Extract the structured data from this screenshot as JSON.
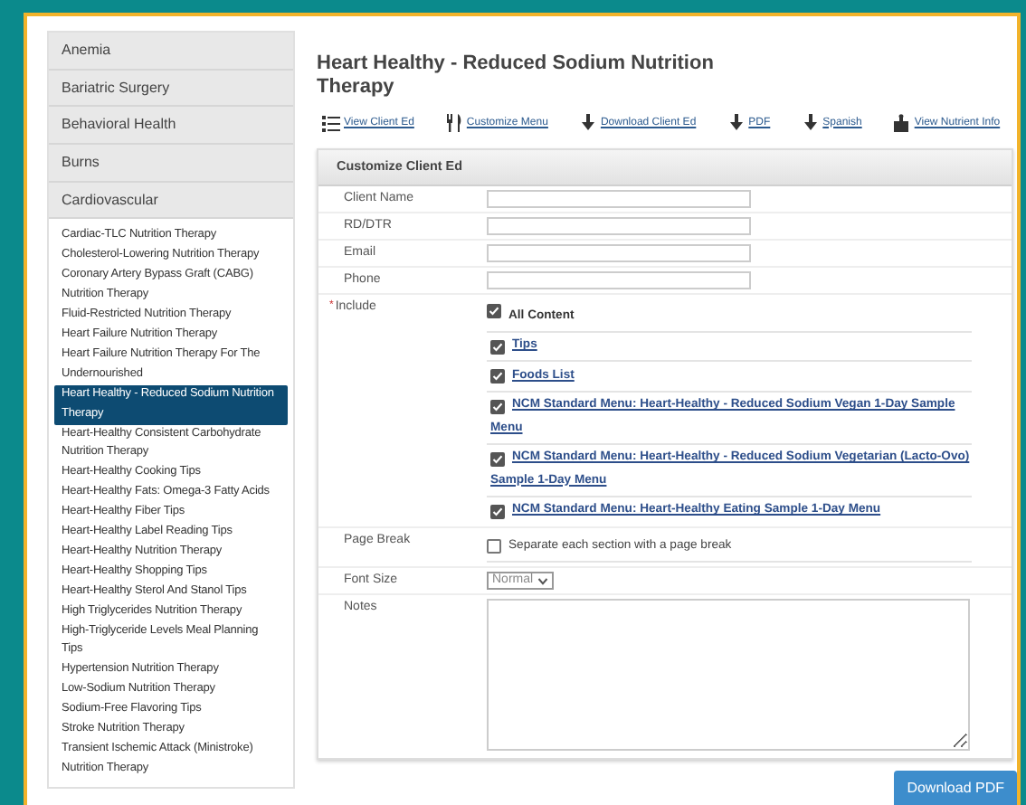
{
  "sidebar": {
    "sections": [
      {
        "label": "Anemia"
      },
      {
        "label": "Bariatric Surgery"
      },
      {
        "label": "Behavioral Health"
      },
      {
        "label": "Burns"
      },
      {
        "label": "Cardiovascular",
        "items": [
          {
            "label": "Cardiac-TLC Nutrition Therapy",
            "selected": false
          },
          {
            "label": "Cholesterol-Lowering Nutrition Therapy",
            "selected": false
          },
          {
            "label": "Coronary Artery Bypass Graft (CABG) Nutrition Therapy",
            "selected": false
          },
          {
            "label": "Fluid-Restricted Nutrition Therapy",
            "selected": false
          },
          {
            "label": "Heart Failure Nutrition Therapy",
            "selected": false
          },
          {
            "label": "Heart Failure Nutrition Therapy For The Undernourished",
            "selected": false
          },
          {
            "label": "Heart Healthy - Reduced Sodium Nutrition Therapy",
            "selected": true
          },
          {
            "label": "Heart-Healthy Consistent Carbohydrate Nutrition Therapy",
            "selected": false
          },
          {
            "label": "Heart-Healthy Cooking Tips",
            "selected": false
          },
          {
            "label": "Heart-Healthy Fats: Omega-3 Fatty Acids",
            "selected": false
          },
          {
            "label": "Heart-Healthy Fiber Tips",
            "selected": false
          },
          {
            "label": "Heart-Healthy Label Reading Tips",
            "selected": false
          },
          {
            "label": "Heart-Healthy Nutrition Therapy",
            "selected": false
          },
          {
            "label": "Heart-Healthy Shopping Tips",
            "selected": false
          },
          {
            "label": "Heart-Healthy Sterol And Stanol Tips",
            "selected": false
          },
          {
            "label": "High Triglycerides Nutrition Therapy",
            "selected": false
          },
          {
            "label": "High-Triglyceride Levels Meal Planning Tips",
            "selected": false
          },
          {
            "label": "Hypertension Nutrition Therapy",
            "selected": false
          },
          {
            "label": "Low-Sodium Nutrition Therapy",
            "selected": false
          },
          {
            "label": "Sodium-Free Flavoring Tips",
            "selected": false
          },
          {
            "label": "Stroke Nutrition Therapy",
            "selected": false
          },
          {
            "label": "Transient Ischemic Attack (Ministroke) Nutrition Therapy",
            "selected": false
          }
        ]
      }
    ]
  },
  "title": "Heart Healthy - Reduced Sodium Nutrition Therapy",
  "toolbar": [
    {
      "label": "View Client Ed"
    },
    {
      "label": "Customize Menu"
    },
    {
      "label": "Download Client Ed"
    },
    {
      "label": "PDF"
    },
    {
      "label": "Spanish"
    },
    {
      "label": "View Nutrient Info"
    }
  ],
  "panel": {
    "title": "Customize Client Ed",
    "fields": [
      {
        "label": "Client Name"
      },
      {
        "label": "RD/DTR"
      },
      {
        "label": "Email"
      },
      {
        "label": "Phone"
      }
    ],
    "include": {
      "label": "Include",
      "required_mark": "*",
      "options": [
        {
          "label": "All Content",
          "kind": "plain",
          "checked": true
        },
        {
          "label": "Tips",
          "kind": "link",
          "checked": true
        },
        {
          "label": "Foods List",
          "kind": "link",
          "checked": true
        },
        {
          "label": "NCM Standard Menu: Heart-Healthy - Reduced Sodium Vegan 1-Day Sample Menu",
          "kind": "link",
          "checked": true
        },
        {
          "label": "NCM Standard Menu: Heart-Healthy - Reduced Sodium Vegetarian (Lacto-Ovo) Sample 1-Day Menu",
          "kind": "link",
          "checked": true
        },
        {
          "label": "NCM Standard Menu: Heart-Healthy Eating Sample 1-Day Menu",
          "kind": "link",
          "checked": true
        }
      ]
    },
    "page_break": {
      "label": "Page Break",
      "option": {
        "label": "Separate each section with a page break",
        "checked": false
      }
    },
    "font_size": {
      "label": "Font Size",
      "value": "Normal"
    },
    "notes": {
      "label": "Notes"
    }
  },
  "button": "Download PDF"
}
